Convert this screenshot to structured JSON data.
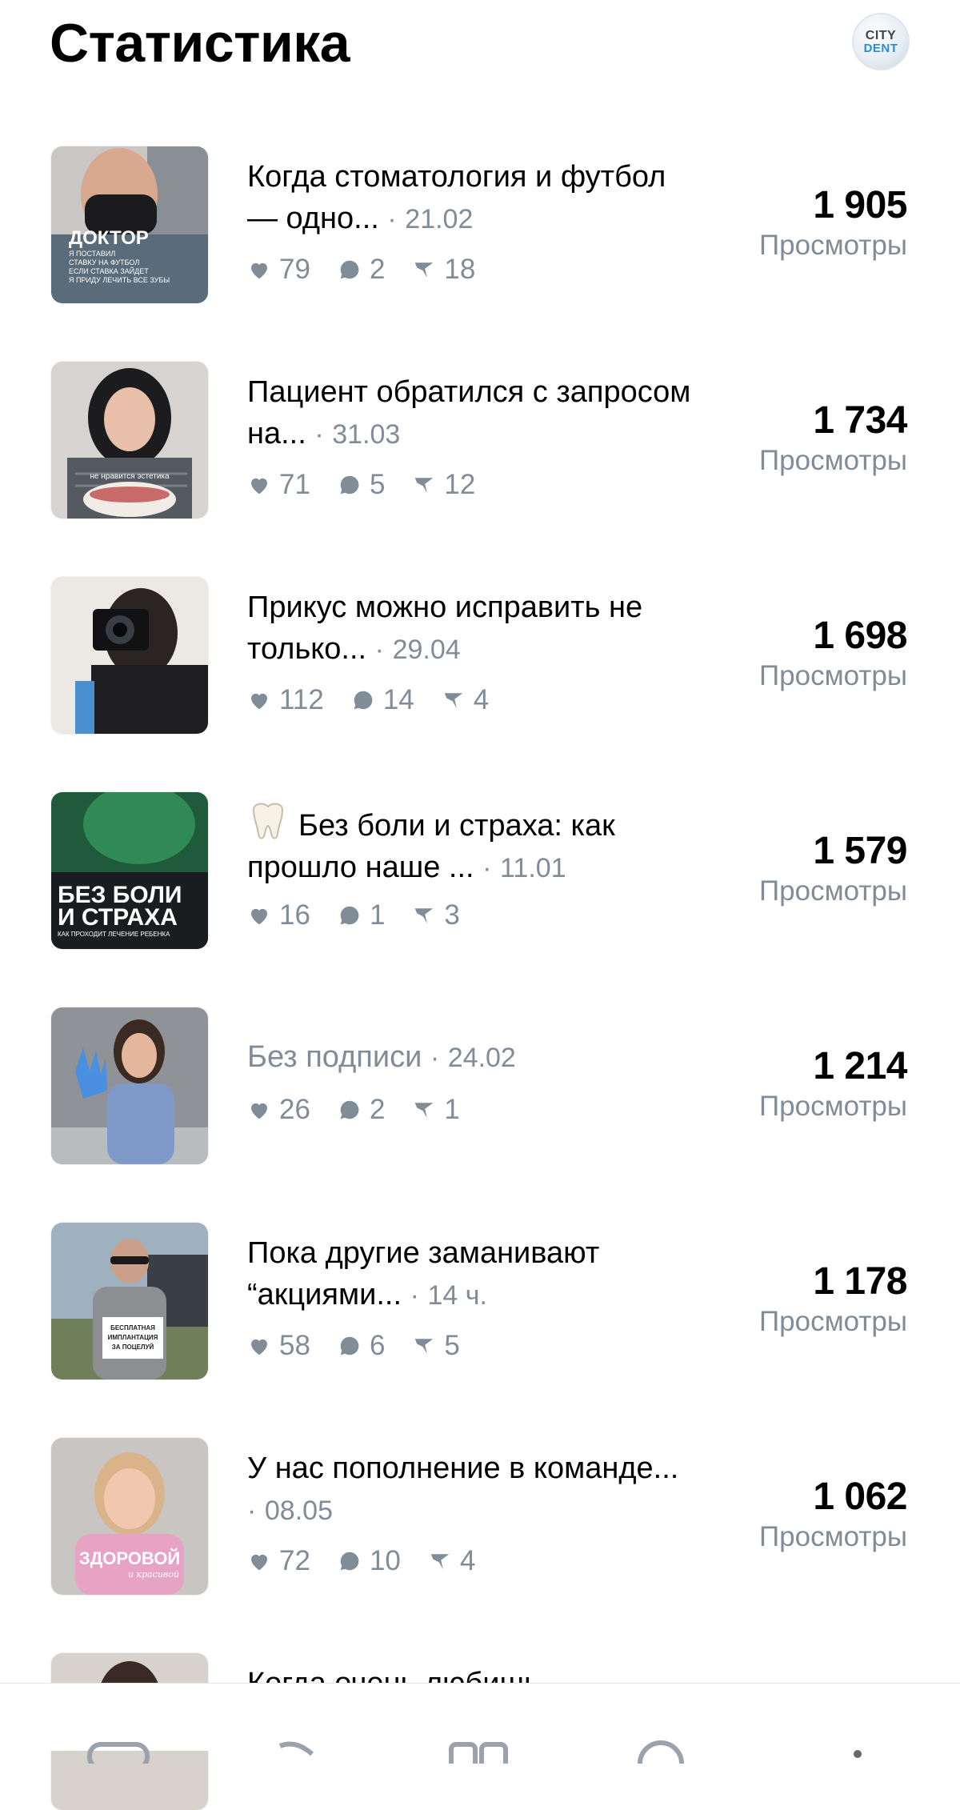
{
  "header": {
    "title": "Статистика",
    "avatar_line1": "CITY",
    "avatar_line2": "DENT"
  },
  "views_label": "Просмотры",
  "posts": [
    {
      "caption": "Когда стоматология и футбол — одно...",
      "date": "21.02",
      "likes": "79",
      "comments": "2",
      "reposts": "18",
      "views": "1 905",
      "thumb_text": [
        "ДОКТОР",
        "Я ПОСТАВИЛ",
        "СТАВКУ НА ФУТБОЛ",
        "ЕСЛИ СТАВКА ЗАЙДЕТ",
        "Я ПРИДУ ЛЕЧИТЬ ВСЕ ЗУБЫ"
      ]
    },
    {
      "caption": "Пациент обратился с запросом на...",
      "date": "31.03",
      "likes": "71",
      "comments": "5",
      "reposts": "12",
      "views": "1 734",
      "thumb_text": [
        "не нравится эстетика"
      ]
    },
    {
      "caption": "Прикус можно исправить не только...",
      "date": "29.04",
      "likes": "112",
      "comments": "14",
      "reposts": "4",
      "views": "1 698",
      "thumb_text": []
    },
    {
      "caption": "Без боли и страха: как прошло наше ...",
      "date": "11.01",
      "likes": "16",
      "comments": "1",
      "reposts": "3",
      "views": "1 579",
      "thumb_text": [
        "БЕЗ БОЛИ",
        "И СТРАХА",
        "КАК ПРОХОДИТ ЛЕЧЕНИЕ РЕБЕНКА"
      ]
    },
    {
      "caption": "Без подписи",
      "date": "24.02",
      "likes": "26",
      "comments": "2",
      "reposts": "1",
      "views": "1 214",
      "thumb_text": []
    },
    {
      "caption": "Пока другие заманивают “акциями...",
      "date": "14 ч.",
      "likes": "58",
      "comments": "6",
      "reposts": "5",
      "views": "1 178",
      "thumb_text": [
        "БЕСПЛАТНАЯ",
        "ИМПЛАНТАЦИЯ",
        "ЗА ПОЦЕЛУЙ"
      ]
    },
    {
      "caption": "У нас пополнение в команде...",
      "date": "08.05",
      "likes": "72",
      "comments": "10",
      "reposts": "4",
      "views": "1 062",
      "thumb_text": [
        "ЗДОРОВОЙ",
        "и красивой"
      ]
    },
    {
      "caption": "Когда очень любишь",
      "date": "",
      "likes": "",
      "comments": "",
      "reposts": "",
      "views": "",
      "thumb_text": []
    }
  ],
  "icons": {
    "like": "heart-icon",
    "comment": "comment-icon",
    "repost": "repost-icon",
    "tooth": "tooth-emoji-icon"
  },
  "colors": {
    "secondary_text": "#818c99",
    "primary_text": "#000000",
    "accent": "#2a8bd8"
  }
}
